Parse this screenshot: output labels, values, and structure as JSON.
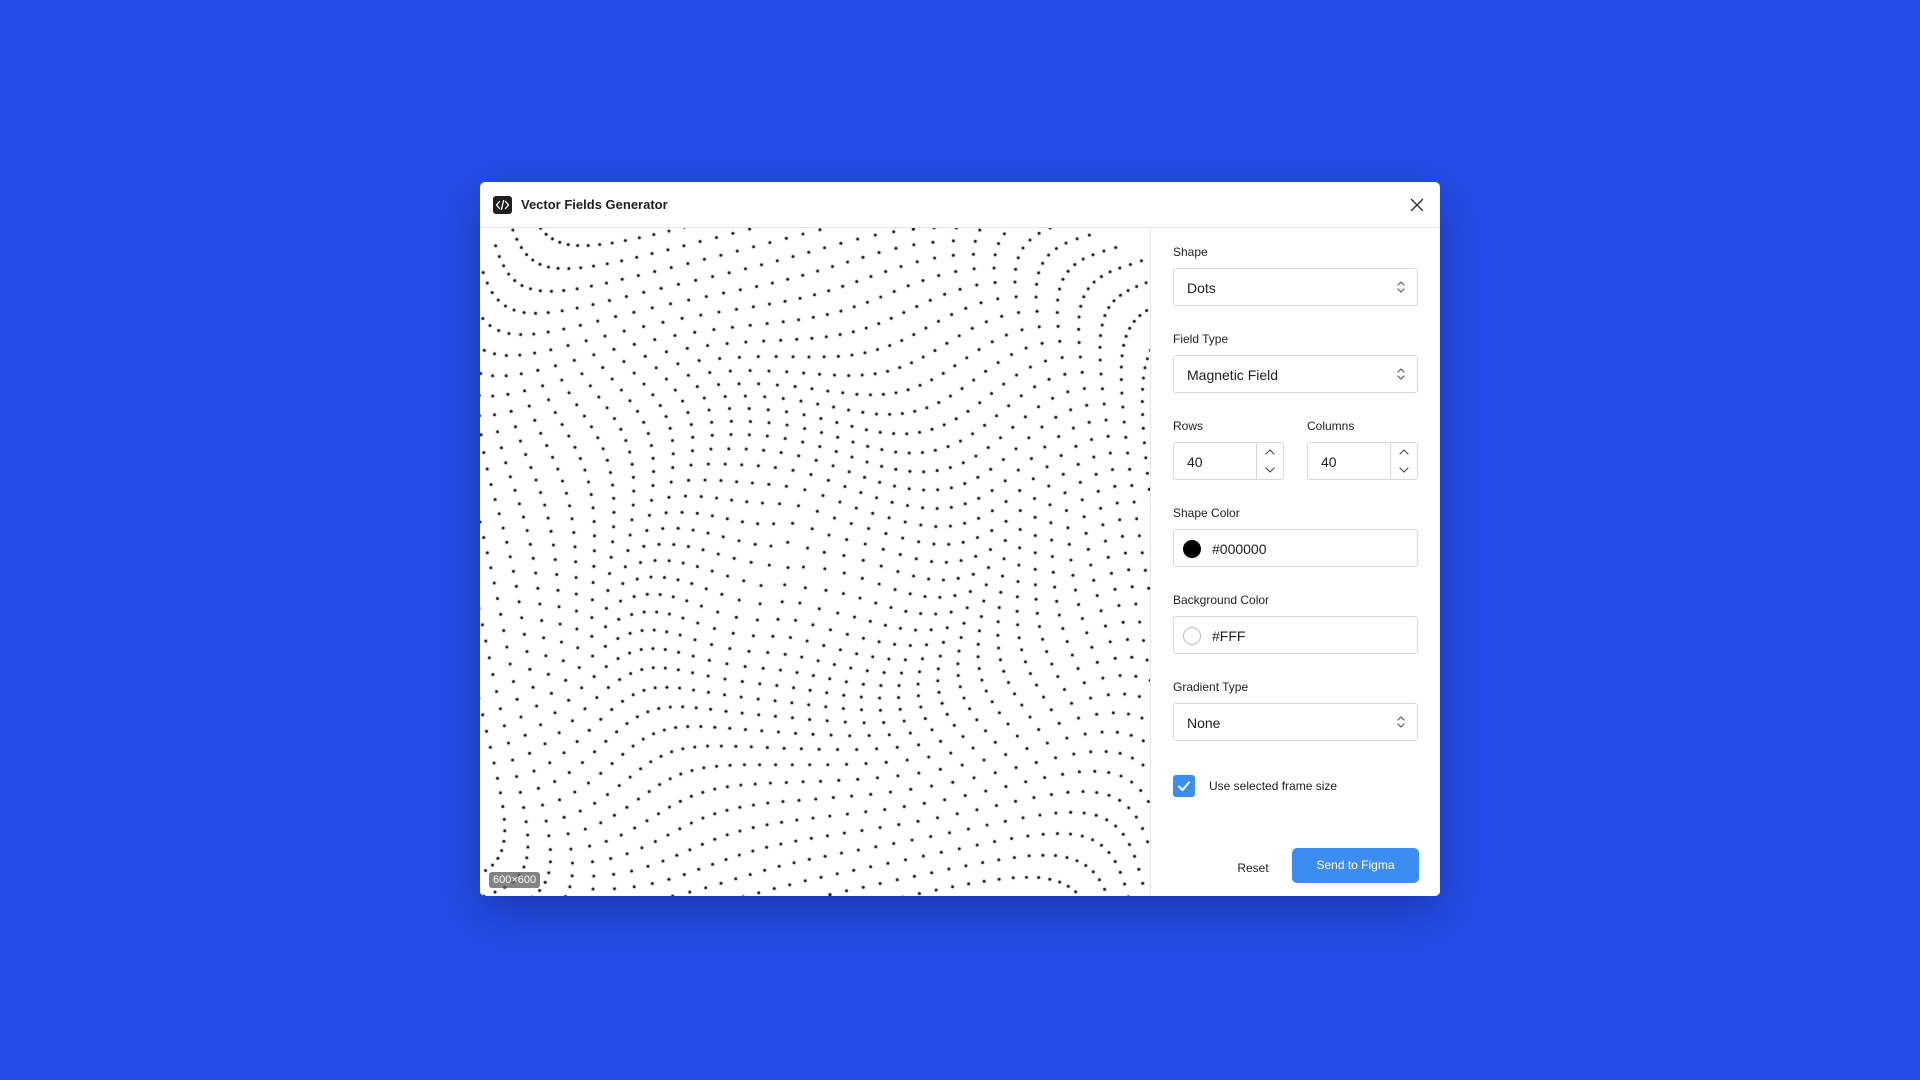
{
  "window": {
    "title": "Vector Fields Generator",
    "app_icon": "code-brackets-icon",
    "close_icon": "close-icon"
  },
  "preview": {
    "size_label": "600×600",
    "dot_color": "#000000",
    "background": "#FFFFFF"
  },
  "settings": {
    "shape": {
      "label": "Shape",
      "value": "Dots"
    },
    "field_type": {
      "label": "Field Type",
      "value": "Magnetic Field"
    },
    "rows": {
      "label": "Rows",
      "value": "40"
    },
    "columns": {
      "label": "Columns",
      "value": "40"
    },
    "shape_color": {
      "label": "Shape Color",
      "value": "#000000",
      "swatch": "#000000"
    },
    "background_color": {
      "label": "Background Color",
      "value": "#FFF",
      "swatch": "#FFFFFF"
    },
    "gradient_type": {
      "label": "Gradient Type",
      "value": "None"
    },
    "use_frame_size": {
      "label": "Use selected frame size",
      "checked": true
    }
  },
  "footer": {
    "reset_label": "Reset",
    "send_label": "Send to Figma"
  },
  "colors": {
    "page_background": "#254CE8",
    "primary_button": "#3B8DF2",
    "checkbox": "#3B8DF2"
  }
}
